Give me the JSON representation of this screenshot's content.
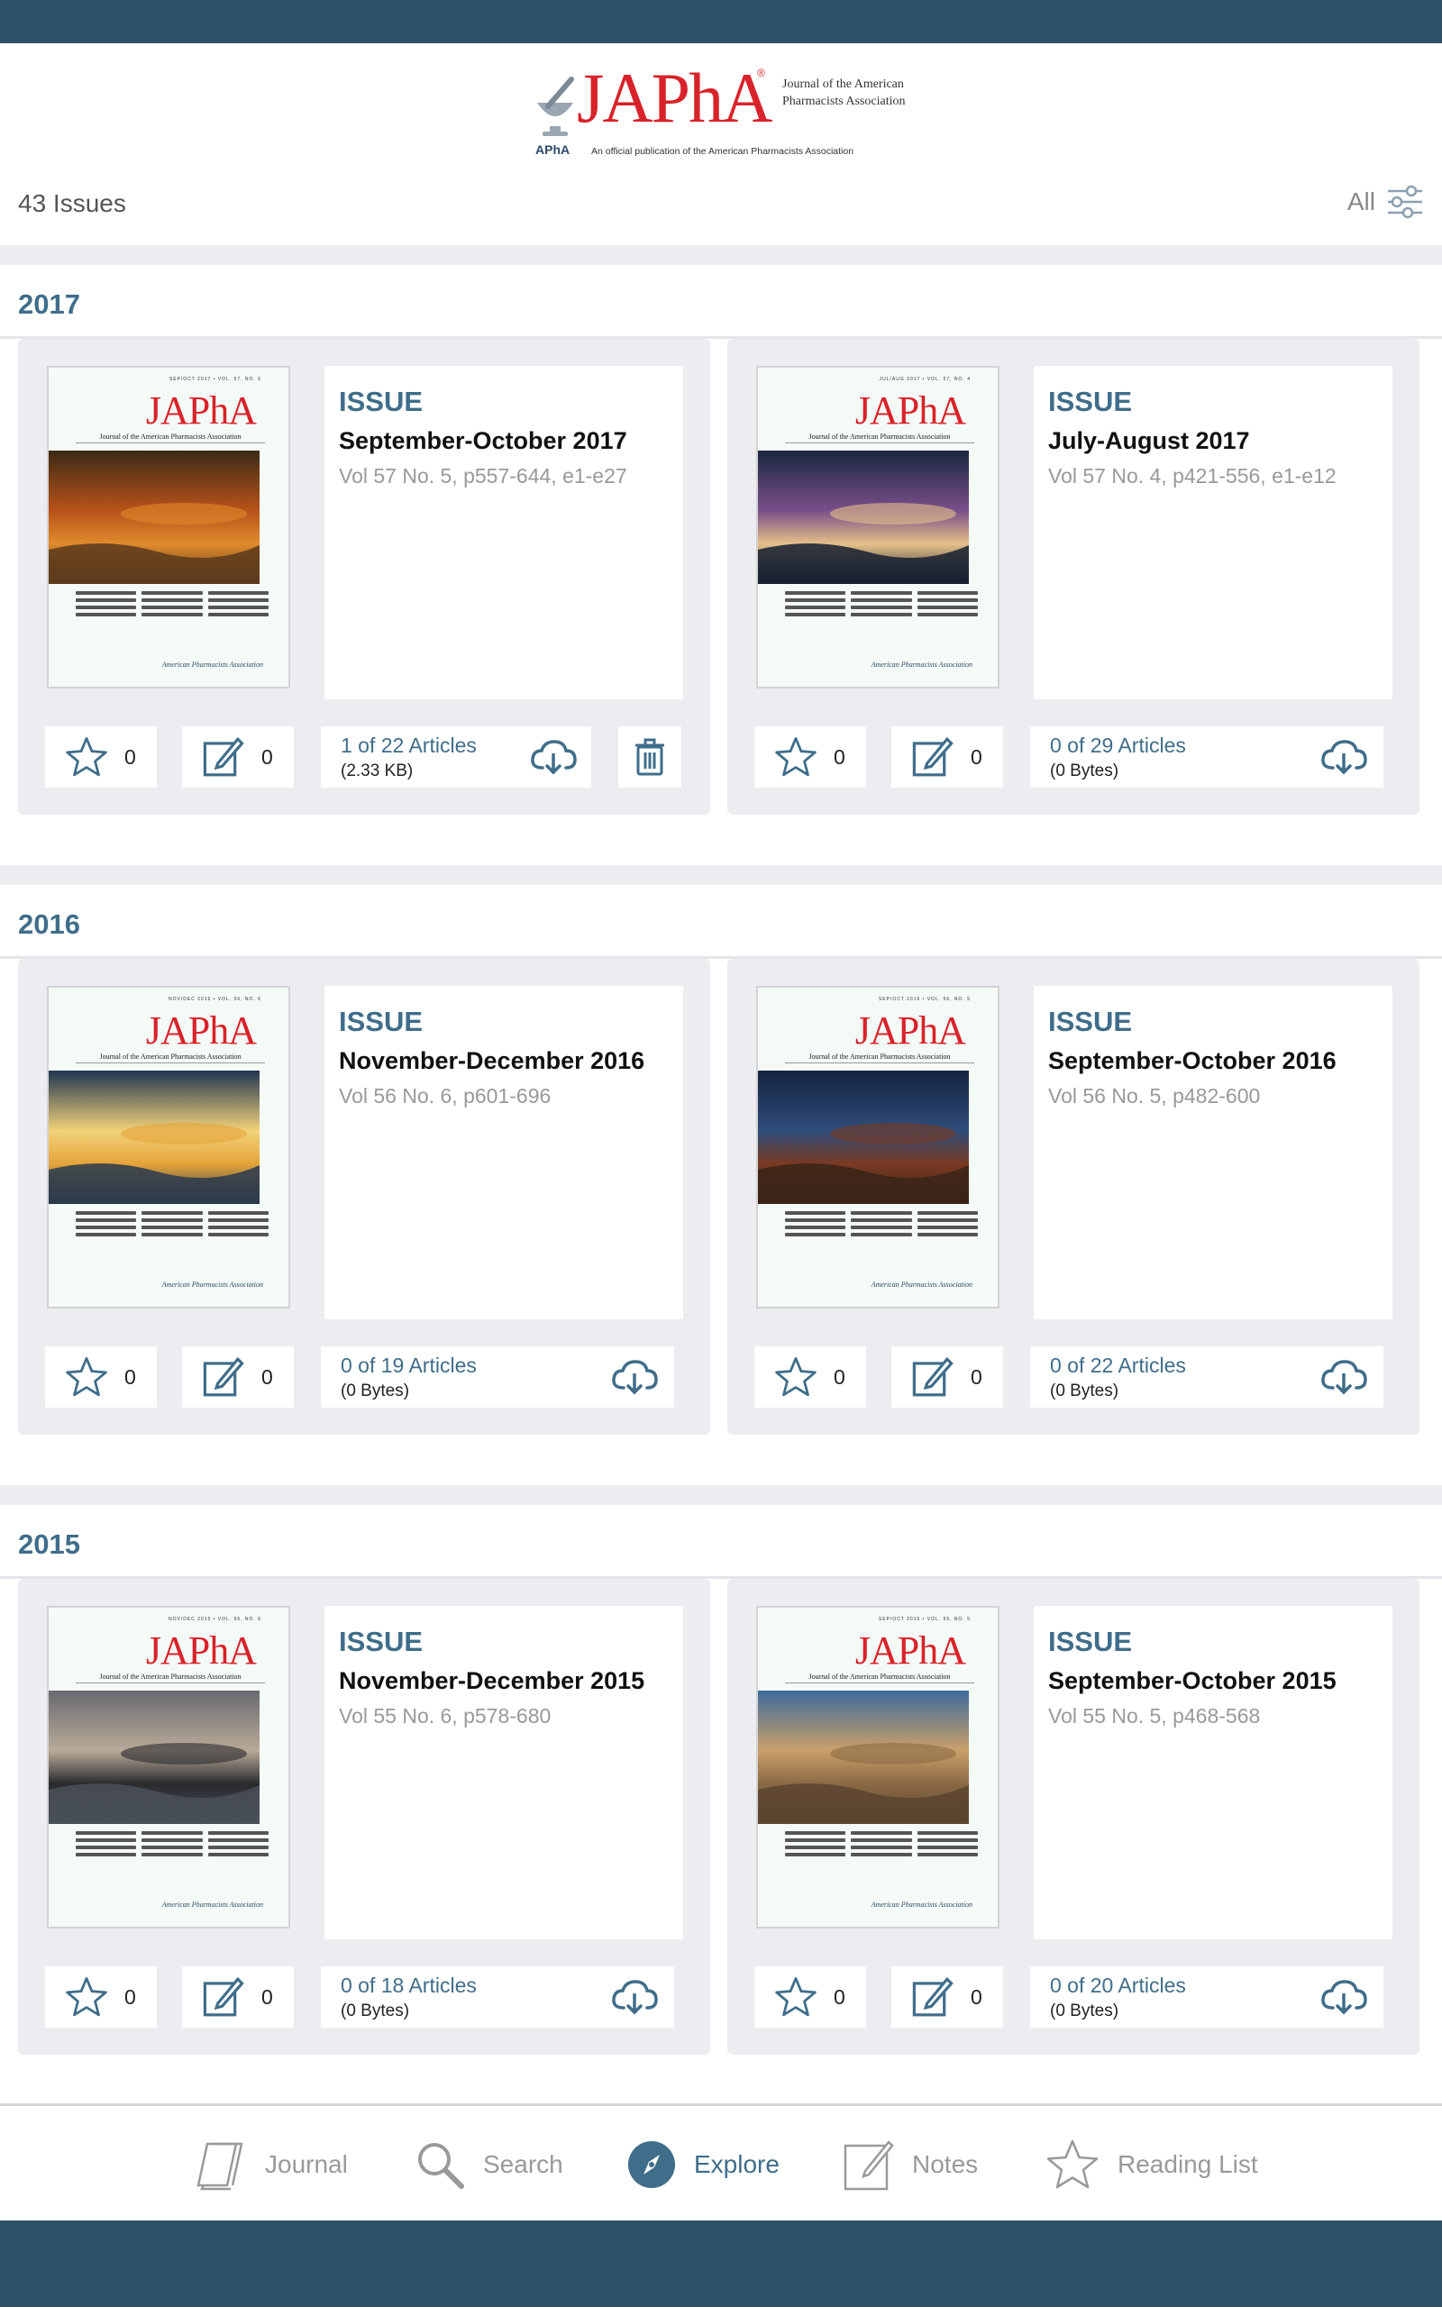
{
  "header": {
    "brand": "JAPhA",
    "reg": "®",
    "full_name": "Journal of the American Pharmacists Association",
    "tagline": "An official publication of the American Pharmacists Association",
    "apha": "APhA"
  },
  "toolbar": {
    "issue_count": "43 Issues",
    "filter_label": "All"
  },
  "cover": {
    "logo": "JAPhA",
    "subtitle": "Journal of the American Pharmacists Association",
    "publisher": "American Pharmacists Association"
  },
  "years": [
    {
      "year": "2017",
      "issues": [
        {
          "kind": "ISSUE",
          "title": "September-October 2017",
          "vol": "Vol 57 No. 5, p557-644, e1-e27",
          "cover_meta": "SEP/OCT 2017 • VOL. 57, NO. 5",
          "stars": "0",
          "notes": "0",
          "articles": "1 of 22 Articles",
          "size": "(2.33 KB)",
          "has_trash": true,
          "photo_colors": [
            "#3b2a14",
            "#b8531a",
            "#e08a2c",
            "#5b3a1c"
          ]
        },
        {
          "kind": "ISSUE",
          "title": "July-August 2017",
          "vol": "Vol 57 No. 4, p421-556, e1-e12",
          "cover_meta": "JUL/AUG 2017 • VOL. 57, NO. 4",
          "stars": "0",
          "notes": "0",
          "articles": "0 of 29 Articles",
          "size": "(0 Bytes)",
          "has_trash": false,
          "photo_colors": [
            "#1a2740",
            "#7a4f8a",
            "#e6c08a",
            "#162030"
          ]
        }
      ]
    },
    {
      "year": "2016",
      "issues": [
        {
          "kind": "ISSUE",
          "title": "November-December 2016",
          "vol": "Vol 56 No. 6, p601-696",
          "cover_meta": "NOV/DEC 2016 • VOL. 56, NO. 6",
          "stars": "0",
          "notes": "0",
          "articles": "0 of 19 Articles",
          "size": "(0 Bytes)",
          "has_trash": false,
          "photo_colors": [
            "#1f3550",
            "#f2d27a",
            "#e4a43a",
            "#2a3a4e"
          ]
        },
        {
          "kind": "ISSUE",
          "title": "September-October 2016",
          "vol": "Vol 56 No. 5, p482-600",
          "cover_meta": "SEP/OCT 2016 • VOL. 56, NO. 5",
          "stars": "0",
          "notes": "0",
          "articles": "0 of 22 Articles",
          "size": "(0 Bytes)",
          "has_trash": false,
          "photo_colors": [
            "#14243f",
            "#2e4c7a",
            "#7a3a22",
            "#3a2418"
          ]
        }
      ]
    },
    {
      "year": "2015",
      "issues": [
        {
          "kind": "ISSUE",
          "title": "November-December 2015",
          "vol": "Vol 55 No. 6, p578-680",
          "cover_meta": "NOV/DEC 2015 • VOL. 55, NO. 6",
          "stars": "0",
          "notes": "0",
          "articles": "0 of 18 Articles",
          "size": "(0 Bytes)",
          "has_trash": false,
          "photo_colors": [
            "#6a6a70",
            "#b8aa98",
            "#2a2a2e",
            "#4a5058"
          ]
        },
        {
          "kind": "ISSUE",
          "title": "September-October 2015",
          "vol": "Vol 55 No. 5, p468-568",
          "cover_meta": "SEP/OCT 2015 • VOL. 55, NO. 5",
          "stars": "0",
          "notes": "0",
          "articles": "0 of 20 Articles",
          "size": "(0 Bytes)",
          "has_trash": false,
          "photo_colors": [
            "#3e6a9c",
            "#c9a06a",
            "#8a6a44",
            "#5a4430"
          ]
        }
      ]
    }
  ],
  "tabs": [
    {
      "label": "Journal",
      "icon": "journal-icon",
      "active": false
    },
    {
      "label": "Search",
      "icon": "search-icon",
      "active": false
    },
    {
      "label": "Explore",
      "icon": "compass-icon",
      "active": true
    },
    {
      "label": "Notes",
      "icon": "notes-icon",
      "active": false
    },
    {
      "label": "Reading List",
      "icon": "star-icon",
      "active": false
    }
  ],
  "colors": {
    "accent": "#3f6d8a",
    "brand_red": "#d8232a",
    "bar": "#2d5166",
    "icon_gray": "#999999"
  }
}
